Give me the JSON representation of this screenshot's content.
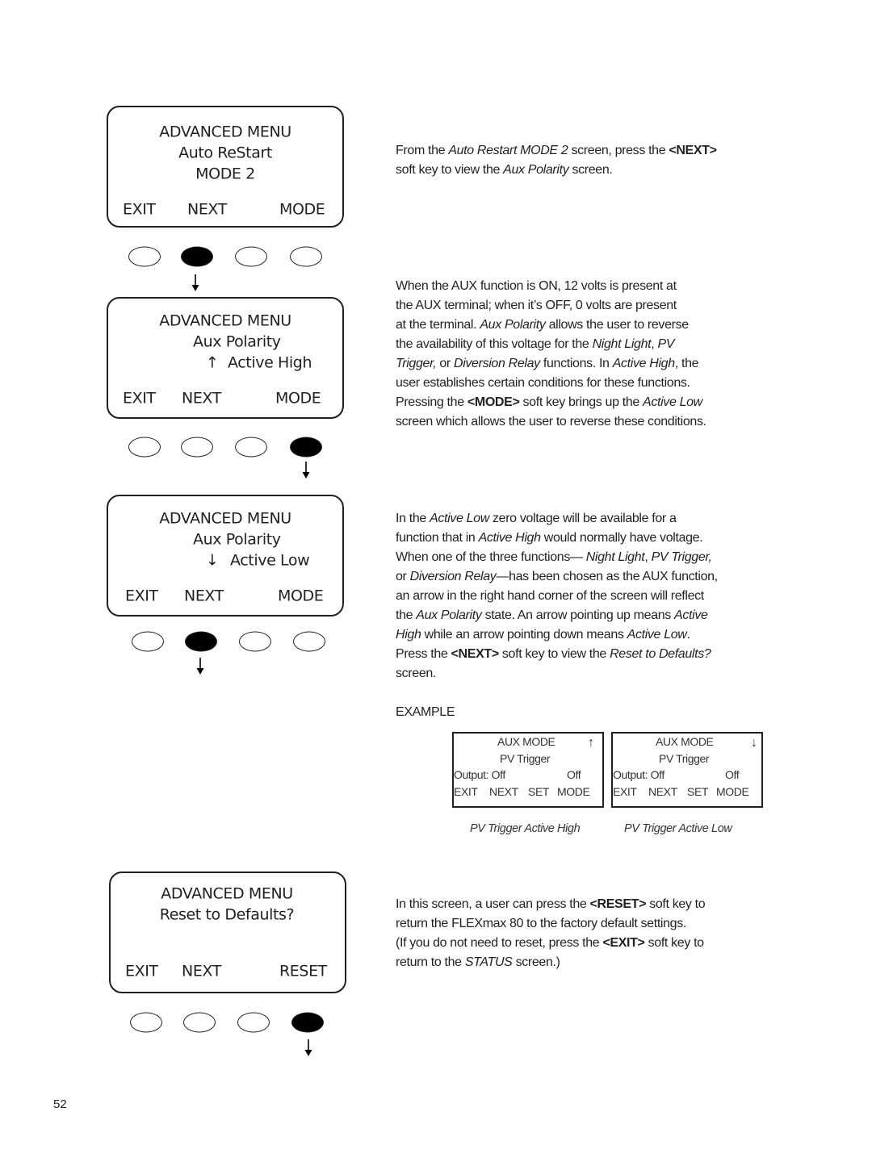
{
  "screens": [
    {
      "lines": [
        "ADVANCED MENU",
        "Auto ReStart",
        "MODE 2"
      ],
      "keys": [
        "EXIT",
        "NEXT",
        "MODE"
      ],
      "pressed_button": 2
    },
    {
      "lines": [
        "ADVANCED MENU",
        "Aux Polarity",
        "Active High"
      ],
      "arrow": "↑",
      "keys": [
        "EXIT",
        "NEXT",
        "MODE"
      ],
      "pressed_button": 4
    },
    {
      "lines": [
        "ADVANCED MENU",
        "Aux Polarity",
        "Active Low"
      ],
      "arrow": "↓",
      "keys": [
        "EXIT",
        "NEXT",
        "MODE"
      ],
      "pressed_button": 2
    },
    {
      "lines": [
        "ADVANCED MENU",
        "Reset to Defaults?"
      ],
      "keys": [
        "EXIT",
        "NEXT",
        "RESET"
      ],
      "pressed_button": 4
    }
  ],
  "paragraphs": [
    [
      [
        {
          "t": "From the "
        },
        {
          "t": "Auto Restart MODE 2",
          "s": "i"
        },
        {
          "t": " screen, press the "
        },
        {
          "t": "<NEXT>",
          "s": "b"
        }
      ],
      [
        {
          "t": "soft key to view the "
        },
        {
          "t": "Aux Polarity",
          "s": "i"
        },
        {
          "t": " screen."
        }
      ]
    ],
    [
      [
        {
          "t": "When the AUX function is ON, 12 volts is present at"
        }
      ],
      [
        {
          "t": "the AUX terminal; when it’s OFF, 0 volts are present"
        }
      ],
      [
        {
          "t": "at the terminal. "
        },
        {
          "t": "Aux Polarity",
          "s": "i"
        },
        {
          "t": " allows the user to reverse"
        }
      ],
      [
        {
          "t": "the availability of this voltage for the "
        },
        {
          "t": "Night Light",
          "s": "i"
        },
        {
          "t": ", "
        },
        {
          "t": "PV",
          "s": "i"
        }
      ],
      [
        {
          "t": "Trigger,",
          "s": "i"
        },
        {
          "t": " or "
        },
        {
          "t": "Diversion Relay",
          "s": "i"
        },
        {
          "t": " functions. In "
        },
        {
          "t": "Active High",
          "s": "i"
        },
        {
          "t": ", the"
        }
      ],
      [
        {
          "t": "user establishes certain conditions for these functions."
        }
      ],
      [
        {
          "t": "Pressing the "
        },
        {
          "t": "<MODE>",
          "s": "b"
        },
        {
          "t": " soft key brings up the "
        },
        {
          "t": "Active Low",
          "s": "i"
        }
      ],
      [
        {
          "t": "screen which allows the user to reverse these conditions."
        }
      ]
    ],
    [
      [
        {
          "t": "In the "
        },
        {
          "t": "Active Low",
          "s": "i"
        },
        {
          "t": " zero voltage will be available for a"
        }
      ],
      [
        {
          "t": "function that in "
        },
        {
          "t": "Active High",
          "s": "i"
        },
        {
          "t": " would normally have voltage."
        }
      ],
      [
        {
          "t": "When one of the three functions— "
        },
        {
          "t": "Night Light",
          "s": "i"
        },
        {
          "t": ", "
        },
        {
          "t": "PV Trigger,",
          "s": "i"
        }
      ],
      [
        {
          "t": "or "
        },
        {
          "t": "Diversion Relay",
          "s": "i"
        },
        {
          "t": "—has been chosen as the AUX function,"
        }
      ],
      [
        {
          "t": "an arrow in the right hand corner of the screen will reflect"
        }
      ],
      [
        {
          "t": "the "
        },
        {
          "t": "Aux Polarity",
          "s": "i"
        },
        {
          "t": " state. An arrow pointing up means "
        },
        {
          "t": "Active",
          "s": "i"
        }
      ],
      [
        {
          "t": "High",
          "s": "i"
        },
        {
          "t": " while an arrow pointing down means "
        },
        {
          "t": "Active Low",
          "s": "i"
        },
        {
          "t": "."
        }
      ],
      [
        {
          "t": "Press the "
        },
        {
          "t": "<NEXT>",
          "s": "b"
        },
        {
          "t": " soft key to view the "
        },
        {
          "t": "Reset to Defaults?",
          "s": "i"
        }
      ],
      [
        {
          "t": "screen."
        }
      ]
    ],
    [
      [
        {
          "t": "In this screen, a user can press the "
        },
        {
          "t": "<RESET>",
          "s": "b"
        },
        {
          "t": " soft key to"
        }
      ],
      [
        {
          "t": "return the FLEXmax 80 to the factory default settings."
        }
      ],
      [
        {
          "t": "(If you do not need to reset, press the "
        },
        {
          "t": "<EXIT>",
          "s": "b"
        },
        {
          "t": " soft key to"
        }
      ],
      [
        {
          "t": "return to the "
        },
        {
          "t": "STATUS",
          "s": "i"
        },
        {
          "t": " screen.)"
        }
      ]
    ]
  ],
  "example": {
    "label": "EXAMPLE",
    "panels": [
      {
        "title": "AUX MODE",
        "arrow": "↑",
        "function": "PV Trigger",
        "output": "Output: Off",
        "state": "Off",
        "keys": [
          "EXIT",
          "NEXT",
          "SET",
          "MODE"
        ],
        "caption": "PV Trigger Active High"
      },
      {
        "title": "AUX MODE",
        "arrow": "↓",
        "function": "PV Trigger",
        "output": "Output: Off",
        "state": "Off",
        "keys": [
          "EXIT",
          "NEXT",
          "SET",
          "MODE"
        ],
        "caption": "PV Trigger Active Low"
      }
    ]
  },
  "page_number": "52"
}
